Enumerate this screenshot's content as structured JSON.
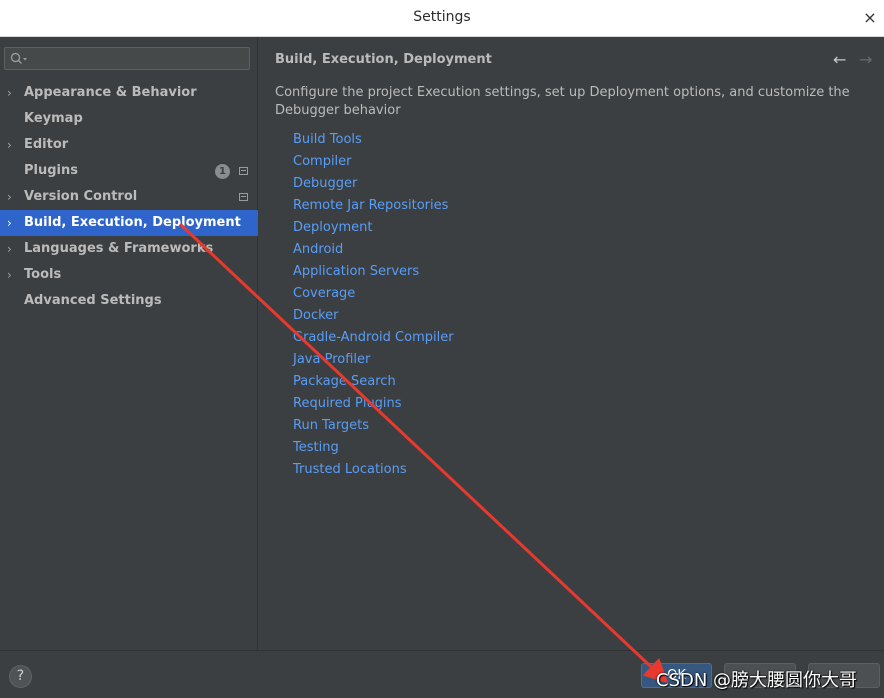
{
  "window": {
    "title": "Settings",
    "close_icon": "×"
  },
  "search": {
    "placeholder": ""
  },
  "sidebar": {
    "items": [
      {
        "label": "Appearance & Behavior",
        "expandable": true
      },
      {
        "label": "Keymap",
        "expandable": false
      },
      {
        "label": "Editor",
        "expandable": true
      },
      {
        "label": "Plugins",
        "expandable": false,
        "badge": "1"
      },
      {
        "label": "Version Control",
        "expandable": true
      },
      {
        "label": "Build, Execution, Deployment",
        "expandable": true,
        "selected": true
      },
      {
        "label": "Languages & Frameworks",
        "expandable": true
      },
      {
        "label": "Tools",
        "expandable": true
      },
      {
        "label": "Advanced Settings",
        "expandable": false
      }
    ]
  },
  "main": {
    "heading": "Build, Execution, Deployment",
    "back_icon": "←",
    "forward_icon": "→",
    "description": "Configure the project Execution settings, set up Deployment options, and customize the Debugger behavior",
    "links": [
      "Build Tools",
      "Compiler",
      "Debugger",
      "Remote Jar Repositories",
      "Deployment",
      "Android",
      "Application Servers",
      "Coverage",
      "Docker",
      "Gradle-Android Compiler",
      "Java Profiler",
      "Package Search",
      "Required Plugins",
      "Run Targets",
      "Testing",
      "Trusted Locations"
    ]
  },
  "footer": {
    "help_label": "?",
    "ok_label": "OK",
    "cancel_label": "",
    "apply_label": ""
  },
  "watermark": "CSDN @膀大腰圆你大哥",
  "colors": {
    "background": "#3c3f41",
    "selection": "#2f65ca",
    "link": "#589df6",
    "text": "#bbbbbb",
    "annotation_arrow": "#e8392e"
  }
}
